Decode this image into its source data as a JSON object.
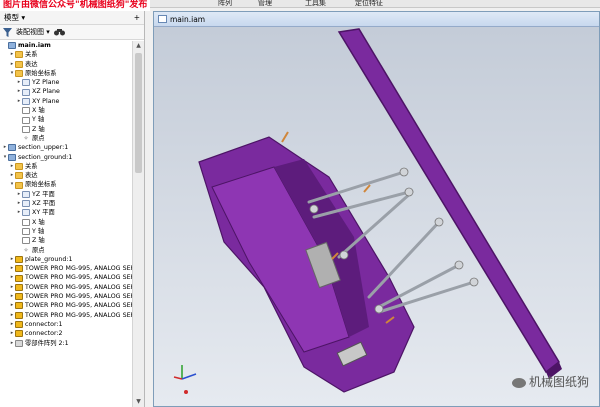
{
  "watermark_top": "图片由微信公众号\"机械图纸狗\"发布",
  "ribbon": {
    "tabs": [
      "阵列",
      "管理",
      "工具集",
      "定位特征"
    ]
  },
  "browser": {
    "title": "模型",
    "title_caret": "▾",
    "toolbar_label": "装配视图",
    "tree": [
      {
        "indent": 0,
        "exp": "",
        "icon": "asm",
        "label": "main.iam",
        "bold": true
      },
      {
        "indent": 1,
        "exp": "▸",
        "icon": "folder",
        "label": "关系"
      },
      {
        "indent": 1,
        "exp": "▸",
        "icon": "folder",
        "label": "表达"
      },
      {
        "indent": 1,
        "exp": "▾",
        "icon": "folder",
        "label": "原始坐标系"
      },
      {
        "indent": 2,
        "exp": "▸",
        "icon": "plane",
        "label": "YZ Plane"
      },
      {
        "indent": 2,
        "exp": "▸",
        "icon": "plane",
        "label": "XZ Plane"
      },
      {
        "indent": 2,
        "exp": "▸",
        "icon": "plane",
        "label": "XY Plane"
      },
      {
        "indent": 2,
        "exp": "",
        "icon": "axis",
        "label": "X 轴"
      },
      {
        "indent": 2,
        "exp": "",
        "icon": "axis",
        "label": "Y 轴"
      },
      {
        "indent": 2,
        "exp": "",
        "icon": "axis",
        "label": "Z 轴"
      },
      {
        "indent": 2,
        "exp": "",
        "icon": "point",
        "label": "原点"
      },
      {
        "indent": 0,
        "exp": "▸",
        "icon": "asm",
        "label": "section_upper:1"
      },
      {
        "indent": 0,
        "exp": "▾",
        "icon": "asm",
        "label": "section_ground:1"
      },
      {
        "indent": 1,
        "exp": "▸",
        "icon": "folder",
        "label": "关系"
      },
      {
        "indent": 1,
        "exp": "▸",
        "icon": "folder",
        "label": "表达"
      },
      {
        "indent": 1,
        "exp": "▾",
        "icon": "folder",
        "label": "原始坐标系"
      },
      {
        "indent": 2,
        "exp": "▸",
        "icon": "plane",
        "label": "YZ 平面"
      },
      {
        "indent": 2,
        "exp": "▸",
        "icon": "plane",
        "label": "XZ 平面"
      },
      {
        "indent": 2,
        "exp": "▸",
        "icon": "plane",
        "label": "XY 平面"
      },
      {
        "indent": 2,
        "exp": "",
        "icon": "axis",
        "label": "X 轴"
      },
      {
        "indent": 2,
        "exp": "",
        "icon": "axis",
        "label": "Y 轴"
      },
      {
        "indent": 2,
        "exp": "",
        "icon": "axis",
        "label": "Z 轴"
      },
      {
        "indent": 2,
        "exp": "",
        "icon": "point",
        "label": "原点"
      },
      {
        "indent": 1,
        "exp": "▸",
        "icon": "part",
        "label": "plate_ground:1"
      },
      {
        "indent": 1,
        "exp": "▸",
        "icon": "part",
        "label": "TOWER PRO MG-995, ANALOG SERV"
      },
      {
        "indent": 1,
        "exp": "▸",
        "icon": "part",
        "label": "TOWER PRO MG-995, ANALOG SERV"
      },
      {
        "indent": 1,
        "exp": "▸",
        "icon": "part",
        "label": "TOWER PRO MG-995, ANALOG SERV"
      },
      {
        "indent": 1,
        "exp": "▸",
        "icon": "part",
        "label": "TOWER PRO MG-995, ANALOG SERV"
      },
      {
        "indent": 1,
        "exp": "▸",
        "icon": "part",
        "label": "TOWER PRO MG-995, ANALOG SERV"
      },
      {
        "indent": 1,
        "exp": "▸",
        "icon": "part",
        "label": "TOWER PRO MG-995, ANALOG SERV"
      },
      {
        "indent": 1,
        "exp": "▸",
        "icon": "part",
        "label": "connector:1"
      },
      {
        "indent": 1,
        "exp": "▸",
        "icon": "part",
        "label": "connector:2"
      },
      {
        "indent": 1,
        "exp": "▸",
        "icon": "pattern",
        "label": "零部件阵列 2:1"
      }
    ]
  },
  "graphics_window": {
    "title": "main.iam"
  },
  "watermark_bottom": "机械图纸狗",
  "colors": {
    "part_purple": "#7a2a9e",
    "part_purple_dark": "#4d1466",
    "rod_gray": "#9aa0a8",
    "viewport_top": "#c4ccd8",
    "viewport_bottom": "#e6eaf0"
  },
  "icons": {
    "filter": "funnel-icon",
    "search": "binoculars-icon"
  }
}
